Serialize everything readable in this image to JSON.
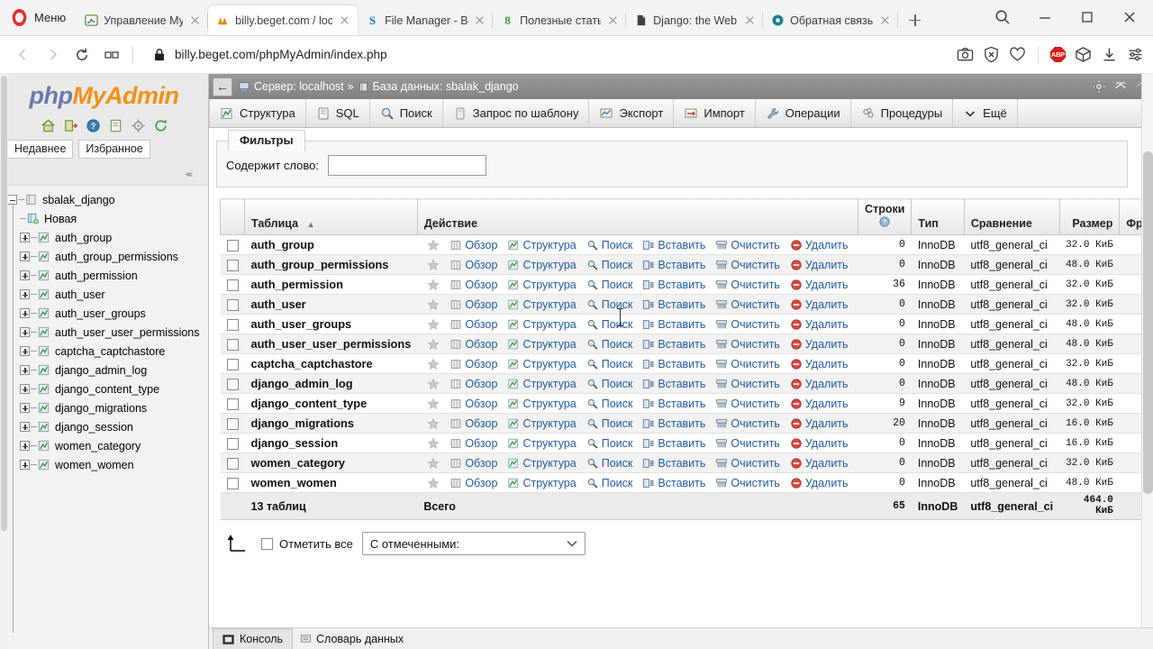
{
  "browser": {
    "opera_menu_label": "Меню",
    "tabs": [
      {
        "title": "Управление MySQL",
        "favicon": "mysql-dolphin-icon",
        "active": false
      },
      {
        "title": "billy.beget.com / loc",
        "favicon": "phpmyadmin-icon",
        "active": true
      },
      {
        "title": "File Manager - Beget",
        "favicon": "beget-s-icon",
        "active": false
      },
      {
        "title": "Полезные статьи. Р",
        "favicon": "skillbox-icon",
        "active": false
      },
      {
        "title": "Django: the Web fra",
        "favicon": "document-icon",
        "active": false
      },
      {
        "title": "Обратная связь",
        "favicon": "feedback-icon",
        "active": false
      }
    ],
    "new_tab_label": "+",
    "window_controls": [
      "search-icon",
      "minimize-icon",
      "maximize-icon",
      "close-icon"
    ],
    "address": {
      "url": "billy.beget.com/phpMyAdmin/index.php",
      "lock_icon": "lock-icon",
      "back_icon": "back-arrow-icon",
      "forward_icon": "forward-arrow-icon",
      "reload_icon": "reload-icon",
      "tabtile_icon": "tab-tiling-icon"
    },
    "omnibox_icons": [
      "snapshot-camera-icon",
      "shield-block-icon",
      "heart-icon",
      "adblock-plus-icon",
      "cube-extension-icon",
      "download-icon",
      "settings-sliders-icon"
    ],
    "adblock_label": "ABP"
  },
  "sidebar": {
    "logo": {
      "php": "php",
      "my": "My",
      "admin": "Admin"
    },
    "quick_icons": [
      "home-icon",
      "logout-icon",
      "help-docs-icon",
      "documentation-icon",
      "settings-gear-icon",
      "reload-refresh-icon"
    ],
    "buttons": [
      {
        "label": "Недавнее"
      },
      {
        "label": "Избранное"
      }
    ],
    "collapse_label": "≪",
    "tree": {
      "database": "sbalak_django",
      "new_item": "Новая",
      "tables": [
        "auth_group",
        "auth_group_permissions",
        "auth_permission",
        "auth_user",
        "auth_user_groups",
        "auth_user_user_permissions",
        "captcha_captchastore",
        "django_admin_log",
        "django_content_type",
        "django_migrations",
        "django_session",
        "women_category",
        "women_women"
      ]
    }
  },
  "main": {
    "breadcrumb": {
      "back_arrow": "←",
      "server_label": "Сервер: localhost",
      "separator": "»",
      "database_label": "База данных: sbalak_django",
      "server_icon": "server-icon",
      "database_icon": "database-icon",
      "settings_icon": "gear-icon",
      "collapse_icon": "collapse-up-icon",
      "home_icon": "home-small-icon"
    },
    "tabs": [
      {
        "label": "Структура",
        "icon": "structure-icon",
        "active": true
      },
      {
        "label": "SQL",
        "icon": "sql-icon",
        "active": false
      },
      {
        "label": "Поиск",
        "icon": "search-magnifier-icon",
        "active": false
      },
      {
        "label": "Запрос по шаблону",
        "icon": "query-template-icon",
        "active": false
      },
      {
        "label": "Экспорт",
        "icon": "export-icon",
        "active": false
      },
      {
        "label": "Импорт",
        "icon": "import-icon",
        "active": false
      },
      {
        "label": "Операции",
        "icon": "operations-wrench-icon",
        "active": false
      },
      {
        "label": "Процедуры",
        "icon": "routines-icon",
        "active": false
      },
      {
        "label": "Ещё",
        "icon": "chevron-down-icon",
        "active": false
      }
    ],
    "filters": {
      "legend": "Фильтры",
      "contains_label": "Содержит слово:",
      "contains_value": "",
      "contains_placeholder": ""
    },
    "table": {
      "headers": {
        "table": "Таблица",
        "sort_indicator": "▲",
        "action": "Действие",
        "rows": "Строки",
        "rows_help_icon": "help-question-icon",
        "type": "Тип",
        "collation": "Сравнение",
        "size": "Размер",
        "overhead": "Фра"
      },
      "action_labels": {
        "favorite": "",
        "browse": "Обзор",
        "structure": "Структура",
        "search": "Поиск",
        "insert": "Вставить",
        "empty": "Очистить",
        "drop": "Удалить"
      },
      "rows": [
        {
          "name": "auth_group",
          "rows": "0",
          "type": "InnoDB",
          "collation": "utf8_general_ci",
          "size": "32.0 КиБ"
        },
        {
          "name": "auth_group_permissions",
          "rows": "0",
          "type": "InnoDB",
          "collation": "utf8_general_ci",
          "size": "48.0 КиБ"
        },
        {
          "name": "auth_permission",
          "rows": "36",
          "type": "InnoDB",
          "collation": "utf8_general_ci",
          "size": "32.0 КиБ"
        },
        {
          "name": "auth_user",
          "rows": "0",
          "type": "InnoDB",
          "collation": "utf8_general_ci",
          "size": "32.0 КиБ"
        },
        {
          "name": "auth_user_groups",
          "rows": "0",
          "type": "InnoDB",
          "collation": "utf8_general_ci",
          "size": "48.0 КиБ"
        },
        {
          "name": "auth_user_user_permissions",
          "rows": "0",
          "type": "InnoDB",
          "collation": "utf8_general_ci",
          "size": "48.0 КиБ"
        },
        {
          "name": "captcha_captchastore",
          "rows": "0",
          "type": "InnoDB",
          "collation": "utf8_general_ci",
          "size": "32.0 КиБ"
        },
        {
          "name": "django_admin_log",
          "rows": "0",
          "type": "InnoDB",
          "collation": "utf8_general_ci",
          "size": "48.0 КиБ"
        },
        {
          "name": "django_content_type",
          "rows": "9",
          "type": "InnoDB",
          "collation": "utf8_general_ci",
          "size": "32.0 КиБ"
        },
        {
          "name": "django_migrations",
          "rows": "20",
          "type": "InnoDB",
          "collation": "utf8_general_ci",
          "size": "16.0 КиБ"
        },
        {
          "name": "django_session",
          "rows": "0",
          "type": "InnoDB",
          "collation": "utf8_general_ci",
          "size": "16.0 КиБ"
        },
        {
          "name": "women_category",
          "rows": "0",
          "type": "InnoDB",
          "collation": "utf8_general_ci",
          "size": "32.0 КиБ"
        },
        {
          "name": "women_women",
          "rows": "0",
          "type": "InnoDB",
          "collation": "utf8_general_ci",
          "size": "48.0 КиБ"
        }
      ],
      "total": {
        "label": "13 таблиц",
        "action": "Всего",
        "rows": "65",
        "type": "InnoDB",
        "collation": "utf8_general_ci",
        "size": "464.0 КиБ"
      }
    },
    "footer": {
      "check_all_label": "Отметить все",
      "with_selected_label": "С отмеченными:",
      "up_arrow_icon": "select-all-arrow-icon"
    },
    "console": {
      "console_label": "Консоль",
      "dictionary_label": "Словарь данных"
    }
  },
  "colors": {
    "pma_orange": "#f29111",
    "pma_blue": "#6c78af",
    "link_blue": "#235a9f",
    "topbar_gray": "#8c8c8c",
    "abp_red": "#d61b15"
  }
}
